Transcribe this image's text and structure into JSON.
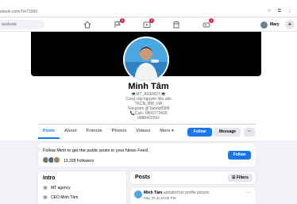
{
  "browser": {
    "url": "ebook.com/Tm71999",
    "star_icon": "star-icon",
    "extension_icon": "puzzle-icon",
    "menu_icon": "kebab-icon"
  },
  "nav": {
    "search_placeholder": "acebook",
    "badges": {
      "pages": "5",
      "watch": "3",
      "gaming": "4"
    },
    "me_name": "Mary",
    "plus": "+"
  },
  "profile": {
    "name": "Minh Tâm",
    "bio": [
      "💻MT_AGENCY💻",
      "Cung cấp nguyên liệu adv",
      "TKCN_BM_VIA",
      "Telegram @Tamdz8999",
      "📞Calo: 0866773435",
      "0888432592"
    ],
    "tabs": [
      "Posts",
      "About",
      "Friends",
      "Photos",
      "Videos",
      "More ▾"
    ],
    "follow_label": "Follow",
    "message_label": "Message",
    "more_label": "···"
  },
  "follow_card": {
    "note": "Follow Minh to get the public posts in your News Feed.",
    "follow_label": "Follow",
    "followers": "13,328 Followers"
  },
  "intro": {
    "title": "Intro",
    "items": [
      "MT agency",
      "CEO Minh Tâm"
    ]
  },
  "posts": {
    "title": "Posts",
    "filters_label": "Filters",
    "first": {
      "author": "Minh Tâm",
      "action": "updated his profile picture.",
      "date": "May 20 at 10:58 PM"
    }
  },
  "colors": {
    "brand": "#1877f2",
    "badge": "#e41e3f"
  }
}
